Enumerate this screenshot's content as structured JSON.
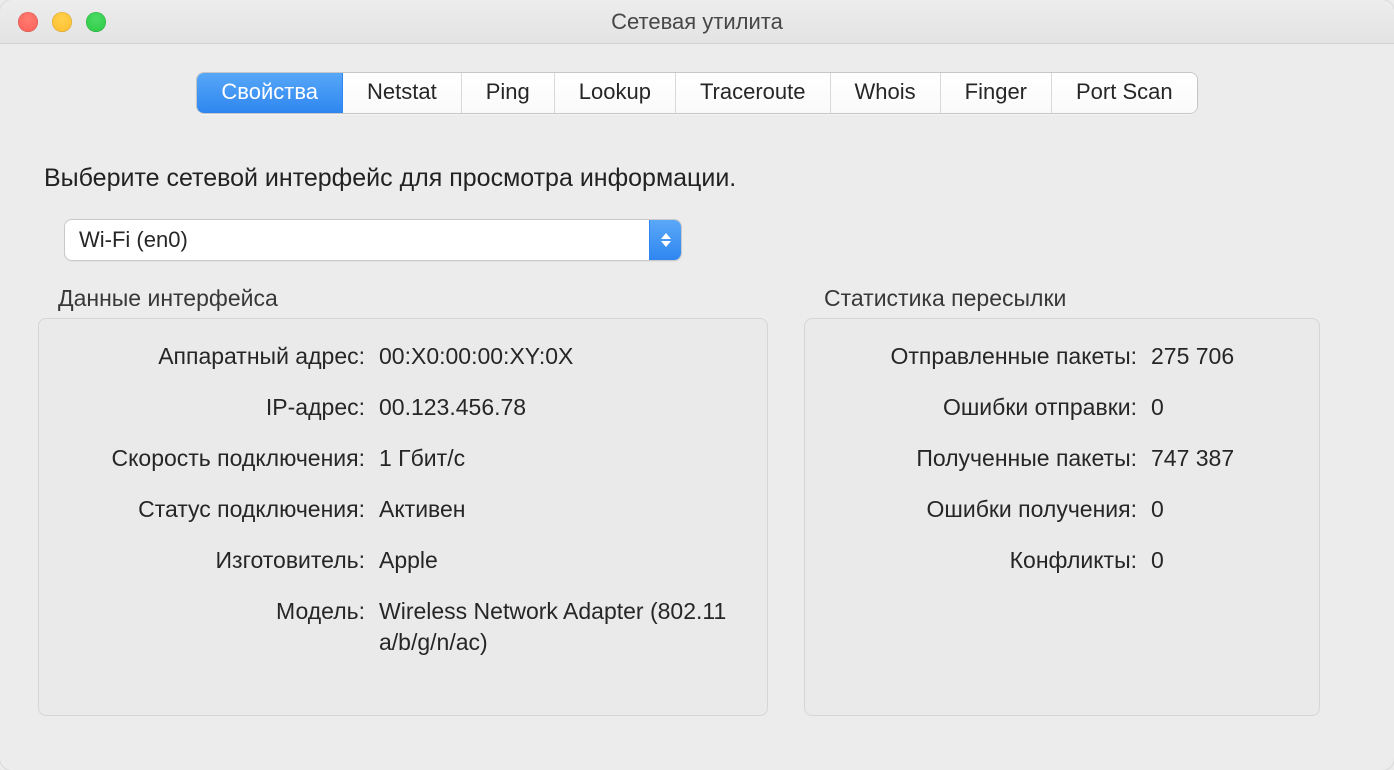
{
  "window": {
    "title": "Сетевая утилита"
  },
  "tabs": [
    {
      "label": "Свойства",
      "active": true
    },
    {
      "label": "Netstat"
    },
    {
      "label": "Ping"
    },
    {
      "label": "Lookup"
    },
    {
      "label": "Traceroute"
    },
    {
      "label": "Whois"
    },
    {
      "label": "Finger"
    },
    {
      "label": "Port Scan"
    }
  ],
  "prompt": "Выберите сетевой интерфейс для просмотра информации.",
  "interface_select": {
    "value": "Wi-Fi (en0)"
  },
  "iface": {
    "title": "Данные интерфейса",
    "hw_label": "Аппаратный адрес:",
    "hw_value": "00:X0:00:00:XY:0X",
    "ip_label": "IP-адрес:",
    "ip_value": "00.123.456.78",
    "speed_label": "Скорость подключения:",
    "speed_value": "1 Гбит/с",
    "status_label": "Статус подключения:",
    "status_value": "Активен",
    "vendor_label": "Изготовитель:",
    "vendor_value": "Apple",
    "model_label": "Модель:",
    "model_value": "Wireless Network Adapter (802.11 a/b/g/n/ac)"
  },
  "stats": {
    "title": "Статистика пересылки",
    "sent_label": "Отправленные пакеты:",
    "sent_value": "275 706",
    "senderr_label": "Ошибки отправки:",
    "senderr_value": "0",
    "recv_label": "Полученные пакеты:",
    "recv_value": "747 387",
    "recverr_label": "Ошибки получения:",
    "recverr_value": "0",
    "coll_label": "Конфликты:",
    "coll_value": "0"
  }
}
